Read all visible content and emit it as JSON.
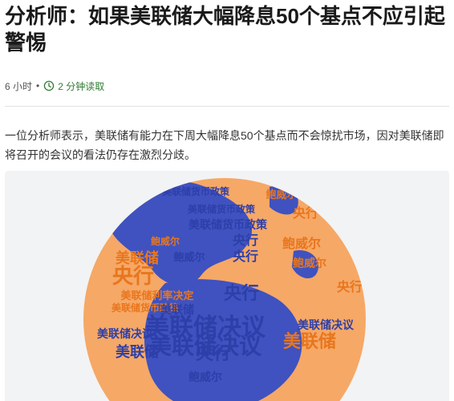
{
  "article": {
    "title": "分析师：如果美联储大幅降息50个基点不应引起警惕",
    "age": "6 小时",
    "separator": "•",
    "read_time": "2 分钟读取",
    "lede": "一位分析师表示，美联储有能力在下周大幅降息50个基点而不会惊扰市场，因对美联储即将召开的会议的看法仍存在激烈分歧。"
  },
  "figure": {
    "words": [
      {
        "text": "美联储货币政策",
        "color": "#2d3fa8"
      },
      {
        "text": "鲍威尔",
        "color": "#e8761e"
      },
      {
        "text": "美联储货币政策",
        "color": "#2d3fa8"
      },
      {
        "text": "央行",
        "color": "#e8761e"
      },
      {
        "text": "美联储货币政策",
        "color": "#2d3fa8"
      },
      {
        "text": "央行",
        "color": "#2d3fa8"
      },
      {
        "text": "鲍威尔",
        "color": "#e8761e"
      },
      {
        "text": "鲍威尔",
        "color": "#e8761e"
      },
      {
        "text": "鲍威尔",
        "color": "#2d3fa8"
      },
      {
        "text": "美联储",
        "color": "#e8761e"
      },
      {
        "text": "央行",
        "color": "#2d3fa8"
      },
      {
        "text": "央行",
        "color": "#e8761e"
      },
      {
        "text": "美联储利率决定",
        "color": "#e8761e"
      },
      {
        "text": "央行",
        "color": "#2d3fa8"
      },
      {
        "text": "美联储货币政策",
        "color": "#e8761e"
      },
      {
        "text": "美联储",
        "color": "#2d3fa8"
      },
      {
        "text": "美联储决议",
        "color": "#2d3fa8"
      },
      {
        "text": "美联储决议",
        "color": "#2d3fa8"
      },
      {
        "text": "美联储",
        "color": "#e8761e"
      },
      {
        "text": "美联储决议",
        "color": "#2d3fa8"
      },
      {
        "text": "央行",
        "color": "#2d3fa8"
      },
      {
        "text": "美联储",
        "color": "#2d3fa8"
      },
      {
        "text": "美联储决议",
        "color": "#2d3fa8"
      },
      {
        "text": "鲍威尔",
        "color": "#e8761e"
      },
      {
        "text": "央行",
        "color": "#e8761e"
      },
      {
        "text": "鲍威尔",
        "color": "#2d3fa8"
      }
    ]
  }
}
